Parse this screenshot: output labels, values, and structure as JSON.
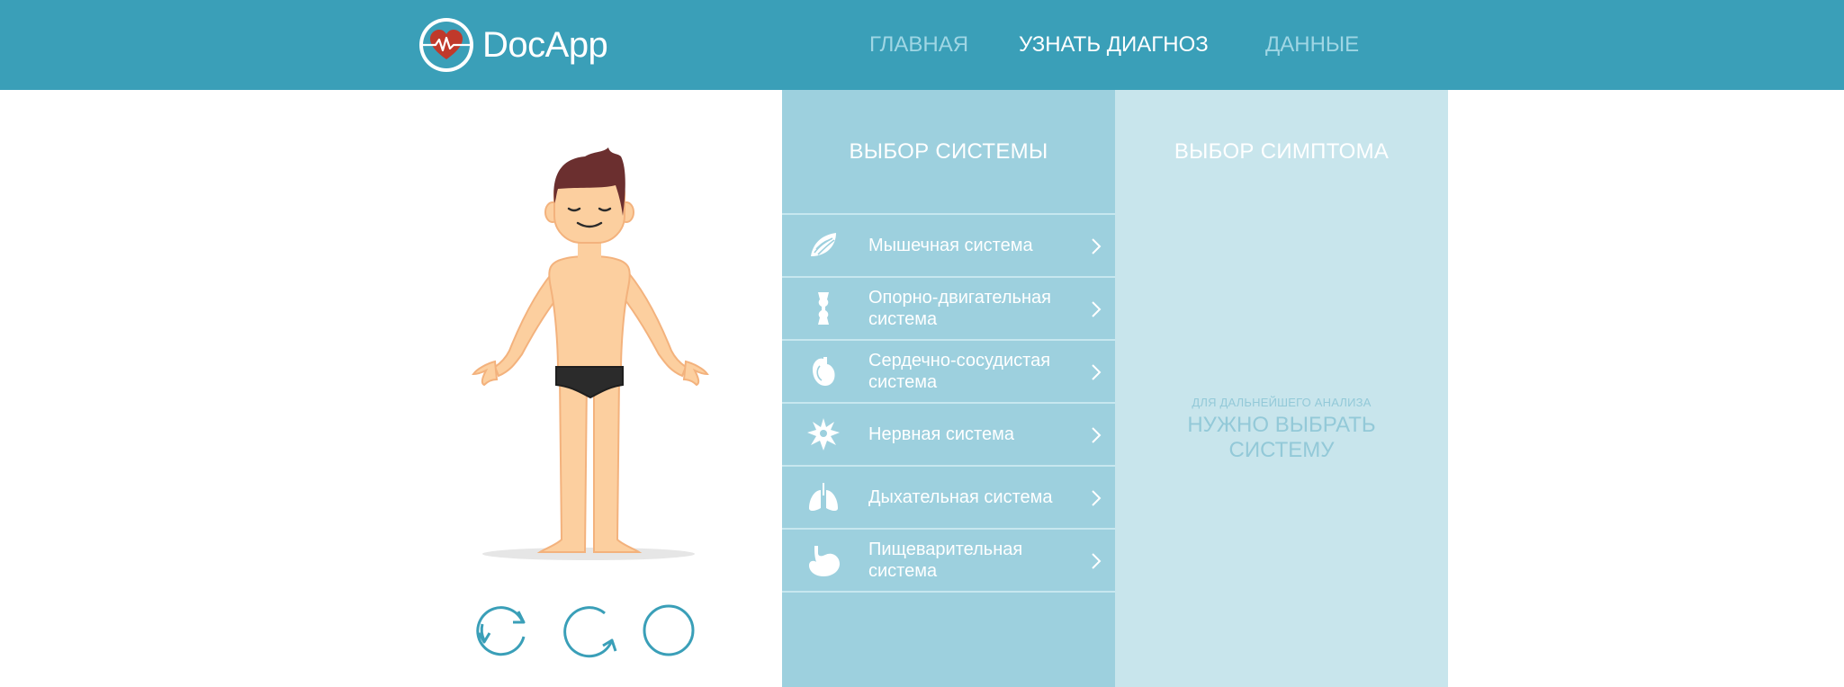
{
  "header": {
    "logo_text": "DocApp",
    "nav": [
      {
        "label": "ГЛАВНАЯ",
        "active": false
      },
      {
        "label": "УЗНАТЬ ДИАГНОЗ",
        "active": true
      },
      {
        "label": "ДАННЫЕ",
        "active": false
      }
    ]
  },
  "figure": {
    "controls": [
      "rotate-left-icon",
      "rotate-right-icon",
      "circle-icon"
    ]
  },
  "systems": {
    "title": "ВЫБОР СИСТЕМЫ",
    "items": [
      {
        "label": "Мышечная система",
        "icon": "muscle-icon"
      },
      {
        "label": "Опорно-двигательная система",
        "icon": "bone-icon"
      },
      {
        "label": "Сердечно-сосудистая система",
        "icon": "heart-icon"
      },
      {
        "label": "Нервная система",
        "icon": "neuron-icon"
      },
      {
        "label": "Дыхательная система",
        "icon": "lungs-icon"
      },
      {
        "label": "Пищеварительная система",
        "icon": "stomach-icon"
      }
    ]
  },
  "symptoms": {
    "title": "ВЫБОР СИМПТОМА",
    "hint_small": "ДЛЯ ДАЛЬНЕЙШЕГО АНАЛИЗА",
    "hint_big": "НУЖНО ВЫБРАТЬ СИСТЕМУ"
  },
  "colors": {
    "header": "#3a9fb8",
    "systems_bg": "#9dd0de",
    "symptoms_bg": "#c8e5ec",
    "accent": "#3a9fb8",
    "skin": "#fccf9f",
    "hair": "#6b2f2f"
  }
}
